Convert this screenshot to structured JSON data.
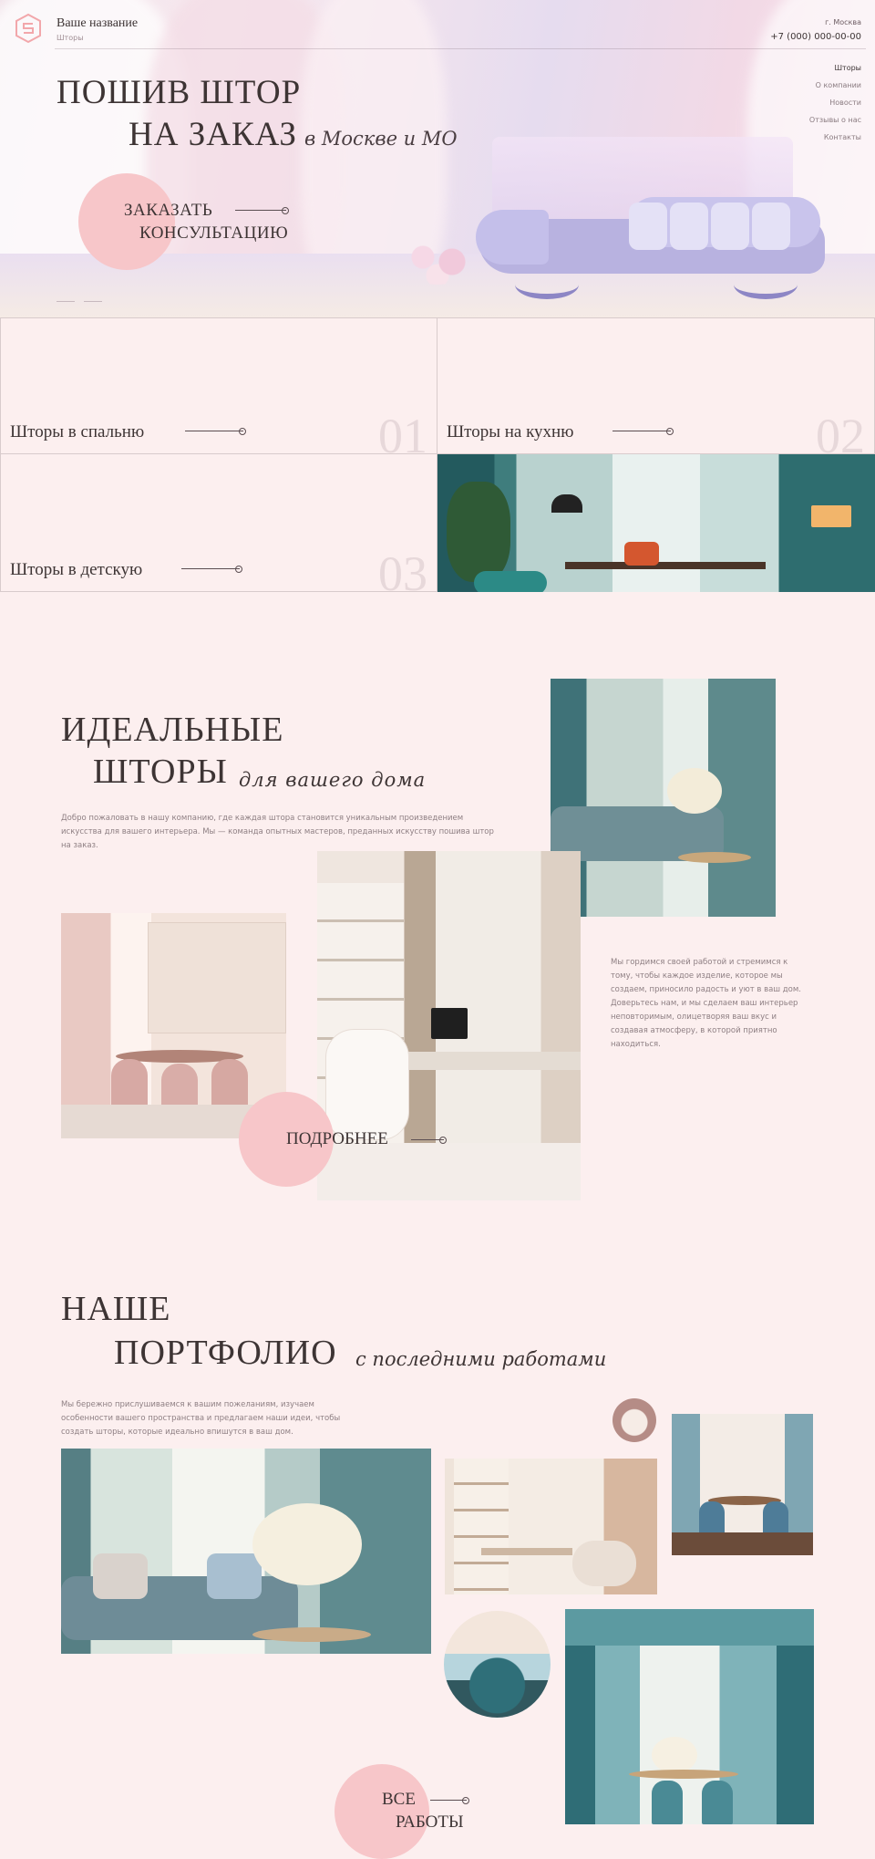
{
  "header": {
    "brand": "Ваше название",
    "brand_sub": "Шторы",
    "city": "г. Москва",
    "phone": "+7 (000) 000-00-00"
  },
  "nav": {
    "items": [
      {
        "label": "Шторы",
        "active": true
      },
      {
        "label": "О компании"
      },
      {
        "label": "Новости"
      },
      {
        "label": "Отзывы о нас"
      },
      {
        "label": "Контакты"
      }
    ]
  },
  "hero": {
    "title_line1": "ПОШИВ ШТОР",
    "title_line2": "НА ЗАКАЗ",
    "title_script": "в Москве и МО",
    "cta_line1": "ЗАКАЗАТЬ",
    "cta_line2": "КОНСУЛЬТАЦИЮ"
  },
  "categories": [
    {
      "label": "Шторы в спальню",
      "number": "01"
    },
    {
      "label": "Шторы на кухню",
      "number": "02"
    },
    {
      "label": "Шторы в детскую",
      "number": "03"
    }
  ],
  "about": {
    "title_line1": "ИДЕАЛЬНЫЕ",
    "title_line2": "ШТОРЫ",
    "title_script": "для вашего дома",
    "intro": "Добро пожаловать в нашу компанию, где каждая штора становится уникальным произведением искусства для вашего интерьера. Мы — команда опытных мастеров, преданных искусству пошива штор на заказ.",
    "text": "Мы гордимся своей работой и стремимся к тому, чтобы каждое изделие, которое мы создаем, приносило радость и уют в ваш дом. Доверьтесь нам, и мы сделаем ваш интерьер неповторимым, олицетворяя ваш вкус и создавая атмосферу, в которой приятно находиться.",
    "cta": "ПОДРОБНЕЕ"
  },
  "portfolio": {
    "title_line1": "НАШЕ",
    "title_line2": "ПОРТФОЛИО",
    "title_script": "с последними работами",
    "intro": "Мы бережно прислушиваемся к вашим пожеланиям, изучаем особенности вашего пространства и предлагаем наши идеи, чтобы создать шторы, которые идеально впишутся в ваш дом.",
    "cta_line1": "ВСЕ",
    "cta_line2": "РАБОТЫ"
  },
  "colors": {
    "background": "#fcefef",
    "accent_circle": "#f7c6c9",
    "text": "#3d3434",
    "muted_text": "#8e7f83"
  },
  "icons": [
    "logo-icon",
    "arrow-right-icon"
  ]
}
